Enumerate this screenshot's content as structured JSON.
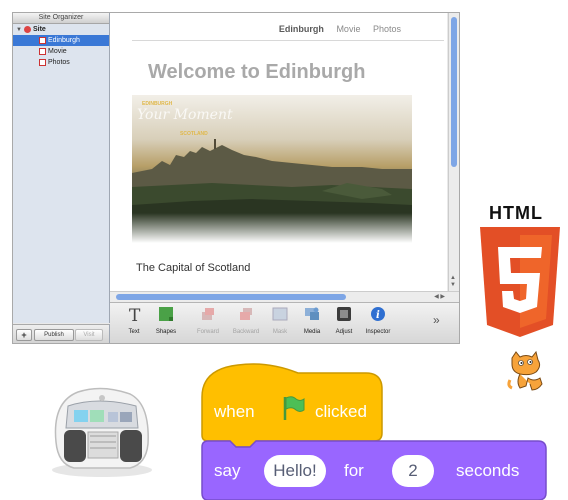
{
  "iweb": {
    "organizer_title": "Site Organizer",
    "site_label": "Site",
    "pages": [
      {
        "label": "Edinburgh",
        "selected": true
      },
      {
        "label": "Movie",
        "selected": false
      },
      {
        "label": "Photos",
        "selected": false
      }
    ],
    "nav": [
      "Edinburgh",
      "Movie",
      "Photos"
    ],
    "welcome": "Welcome to Edinburgh",
    "photo_brand_top": "EDINBURGH",
    "photo_script": "Your Moment",
    "photo_brand_bottom": "SCOTLAND",
    "caption": "The Capital of Scotland",
    "toolbar": [
      {
        "label": "Text",
        "icon": "text-icon",
        "enabled": true
      },
      {
        "label": "Shapes",
        "icon": "shapes-icon",
        "enabled": true
      },
      {
        "label": "Forward",
        "icon": "forward-icon",
        "enabled": false
      },
      {
        "label": "Backward",
        "icon": "backward-icon",
        "enabled": false
      },
      {
        "label": "Mask",
        "icon": "mask-icon",
        "enabled": false
      },
      {
        "label": "Media",
        "icon": "media-icon",
        "enabled": true
      },
      {
        "label": "Adjust",
        "icon": "adjust-icon",
        "enabled": true
      },
      {
        "label": "Inspector",
        "icon": "inspector-icon",
        "enabled": true
      }
    ],
    "overflow": "»",
    "bottom_buttons": {
      "add": "+",
      "publish": "Publish",
      "visit": "Visit"
    },
    "colors": {
      "selection": "#3a78d6",
      "scroll_thumb": "#7ea6e6",
      "sidebar": "#dde4ee"
    }
  },
  "html5": {
    "word": "HTML",
    "colors": {
      "shield": "#e34f26",
      "shield_light": "#ef652a"
    }
  },
  "scratch": {
    "hat": {
      "when": "when",
      "clicked": "clicked",
      "icon": "green-flag-icon",
      "color": "#ffbf00"
    },
    "say": {
      "say": "say",
      "message": "Hello!",
      "for": "for",
      "seconds_value": "2",
      "seconds": "seconds",
      "color": "#9966ff"
    }
  }
}
